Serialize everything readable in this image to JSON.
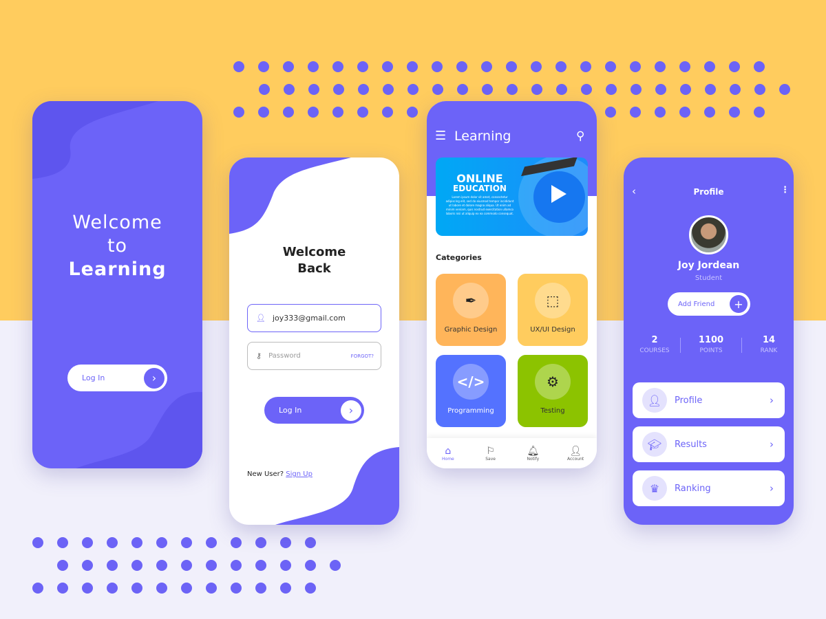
{
  "colors": {
    "primary": "#6C63F8",
    "yellow": "#FFCC5E",
    "background": "#F1F0FB"
  },
  "splash": {
    "title_line1": "Welcome",
    "title_line2": "to",
    "title_line3": "Learning",
    "login_label": "Log In",
    "arrow_icon": "chevron-right"
  },
  "login": {
    "title_line1": "Welcome",
    "title_line2": "Back",
    "email_value": "joy333@gmail.com",
    "password_placeholder": "Password",
    "forgot_label": "FORGOT?",
    "login_label": "Log In",
    "new_user_label": "New User?",
    "signup_label": "Sign Up"
  },
  "home": {
    "title": "Learning",
    "menu_icon": "hamburger",
    "search_icon": "search",
    "banner": {
      "line1": "ONLINE",
      "line2": "EDUCATION",
      "body": "Lorem ipsum dolor sit amet, consectetur adipiscing elit, sed do eiusmod tempor incididunt ut labore et dolore magna aliqua. Ut enim ad minim veniam, quis nostrud exercitation ullamco laboris nisi ut aliquip ex ea commodo consequat."
    },
    "categories_label": "Categories",
    "categories": [
      {
        "label": "Graphic Design",
        "color": "#FFB55A"
      },
      {
        "label": "UX/UI Design",
        "color": "#FFCC5E"
      },
      {
        "label": "Programming",
        "color": "#5472FF"
      },
      {
        "label": "Testing",
        "color": "#8CC300"
      }
    ],
    "nav": [
      {
        "label": "Home",
        "active": true
      },
      {
        "label": "Save"
      },
      {
        "label": "Notify"
      },
      {
        "label": "Account"
      }
    ]
  },
  "profile": {
    "title": "Profile",
    "name": "Joy Jordean",
    "role": "Student",
    "add_friend_label": "Add Friend",
    "stats": [
      {
        "value": "2",
        "label": "COURSES"
      },
      {
        "value": "1100",
        "label": "POINTS"
      },
      {
        "value": "14",
        "label": "RANK"
      }
    ],
    "items": [
      {
        "label": "Profile"
      },
      {
        "label": "Results"
      },
      {
        "label": "Ranking"
      }
    ]
  }
}
